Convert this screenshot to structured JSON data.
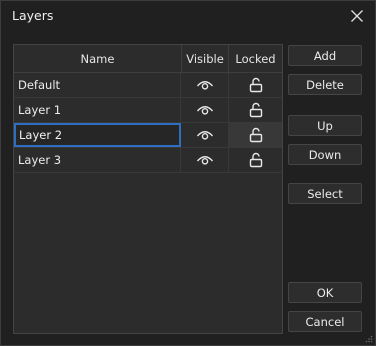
{
  "window": {
    "title": "Layers",
    "close_icon": "close-icon"
  },
  "grid": {
    "columns": [
      "Name",
      "Visible",
      "Locked"
    ],
    "rows": [
      {
        "name": "Default",
        "visible": true,
        "locked": false
      },
      {
        "name": "Layer 1",
        "visible": true,
        "locked": false
      },
      {
        "name": "Layer 2",
        "visible": true,
        "locked": false,
        "editing": true
      },
      {
        "name": "Layer 3",
        "visible": true,
        "locked": false
      }
    ],
    "visible_icon": "eye-icon",
    "locked_icon": "unlocked-padlock-icon"
  },
  "buttons": {
    "add": "Add",
    "delete": "Delete",
    "up": "Up",
    "down": "Down",
    "select": "Select",
    "ok": "OK",
    "cancel": "Cancel"
  },
  "colors": {
    "background": "#202020",
    "grid_background": "#2c2c2c",
    "edit_border": "#2f6fc1"
  }
}
